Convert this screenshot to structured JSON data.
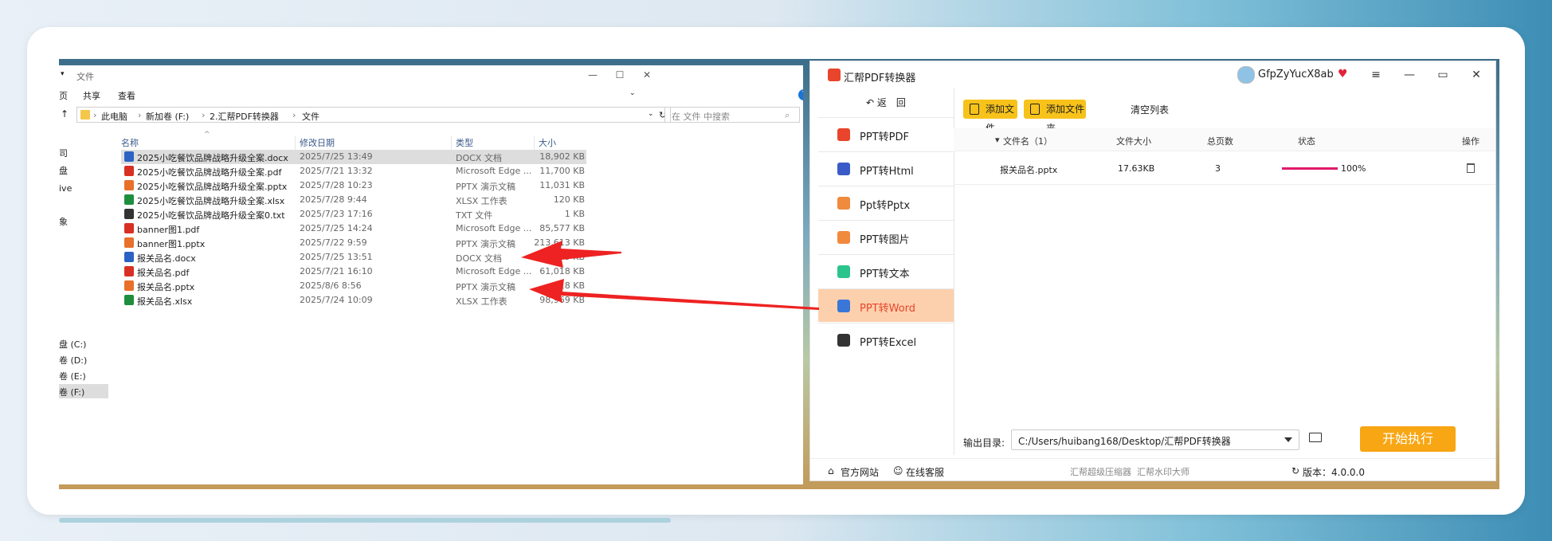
{
  "explorer": {
    "title": "文件",
    "menu": [
      "页",
      "共享",
      "查看"
    ],
    "breadcrumb": [
      "此电脑",
      "新加卷 (F:)",
      "2.汇帮PDF转换器",
      "文件"
    ],
    "search_placeholder": "在 文件 中搜索",
    "sidebar": [
      "司",
      "盘",
      "ive",
      "象",
      "盘 (C:)",
      "卷 (D:)",
      "卷 (E:)",
      "卷 (F:)"
    ],
    "columns": [
      "名称",
      "修改日期",
      "类型",
      "大小"
    ],
    "files": [
      {
        "name": "2025小吃餐饮品牌战略升级全案.docx",
        "date": "2025/7/25 13:49",
        "type": "DOCX 文档",
        "size": "18,902 KB",
        "icon": "word-icon",
        "color": "#2b62c4"
      },
      {
        "name": "2025小吃餐饮品牌战略升级全案.pdf",
        "date": "2025/7/21 13:32",
        "type": "Microsoft Edge ...",
        "size": "11,700 KB",
        "icon": "pdf-icon",
        "color": "#d93025"
      },
      {
        "name": "2025小吃餐饮品牌战略升级全案.pptx",
        "date": "2025/7/28 10:23",
        "type": "PPTX 演示文稿",
        "size": "11,031 KB",
        "icon": "ppt-icon",
        "color": "#e8702a"
      },
      {
        "name": "2025小吃餐饮品牌战略升级全案.xlsx",
        "date": "2025/7/28 9:44",
        "type": "XLSX 工作表",
        "size": "120 KB",
        "icon": "excel-icon",
        "color": "#1e8e3e"
      },
      {
        "name": "2025小吃餐饮品牌战略升级全案0.txt",
        "date": "2025/7/23 17:16",
        "type": "TXT 文件",
        "size": "1 KB",
        "icon": "txt-icon",
        "color": "#333333"
      },
      {
        "name": "banner图1.pdf",
        "date": "2025/7/25 14:24",
        "type": "Microsoft Edge ...",
        "size": "85,577 KB",
        "icon": "pdf-icon",
        "color": "#d93025"
      },
      {
        "name": "banner图1.pptx",
        "date": "2025/7/22 9:59",
        "type": "PPTX 演示文稿",
        "size": "213,613 KB",
        "icon": "ppt-icon",
        "color": "#e8702a"
      },
      {
        "name": "报关品名.docx",
        "date": "2025/7/25 13:51",
        "type": "DOCX 文档",
        "size": "9 KB",
        "icon": "word-icon",
        "color": "#2b62c4"
      },
      {
        "name": "报关品名.pdf",
        "date": "2025/7/21 16:10",
        "type": "Microsoft Edge ...",
        "size": "61,018 KB",
        "icon": "pdf-icon",
        "color": "#d93025"
      },
      {
        "name": "报关品名.pptx",
        "date": "2025/8/6 8:56",
        "type": "PPTX 演示文稿",
        "size": "18 KB",
        "icon": "ppt-icon",
        "color": "#e8702a"
      },
      {
        "name": "报关品名.xlsx",
        "date": "2025/7/24 10:09",
        "type": "XLSX 工作表",
        "size": "98,969 KB",
        "icon": "excel-icon",
        "color": "#1e8e3e"
      }
    ]
  },
  "app": {
    "title": "汇帮PDF转换器",
    "username": "GfpZyYucX8ab",
    "back_label": "返　回",
    "nav": [
      {
        "label": "PPT转PDF",
        "icon": "pdf-icon",
        "color": "#e8452c"
      },
      {
        "label": "PPT转Html",
        "icon": "html-icon",
        "color": "#3a5bc7"
      },
      {
        "label": "Ppt转Pptx",
        "icon": "pptx-icon",
        "color": "#f08a3c"
      },
      {
        "label": "PPT转图片",
        "icon": "image-icon",
        "color": "#f08a3c"
      },
      {
        "label": "PPT转文本",
        "icon": "text-icon",
        "color": "#2bc48c"
      },
      {
        "label": "PPT转Word",
        "icon": "word-icon",
        "color": "#3a76d8"
      },
      {
        "label": "PPT转Excel",
        "icon": "excel-icon",
        "color": "#333333"
      }
    ],
    "active_nav": 5,
    "add_file": "添加文件",
    "add_folder": "添加文件夹",
    "clear_list": "清空列表",
    "table_headers": [
      "文件名（1）",
      "文件大小",
      "总页数",
      "状态",
      "操作"
    ],
    "row": {
      "name": "报关品名.pptx",
      "size": "17.63KB",
      "pages": "3",
      "progress": 100,
      "progress_text": "100%"
    },
    "output_label": "输出目录:",
    "output_path": "C:/Users/huibang168/Desktop/汇帮PDF转换器",
    "start_button": "开始执行",
    "footer": {
      "website": "官方网站",
      "service": "在线客服",
      "compress": "汇帮超级压缩器",
      "watermark": "汇帮水印大师",
      "version": "版本：4.0.0.0"
    }
  },
  "colors": {
    "accent": "#f7c21a",
    "start": "#f8a613",
    "active_nav_bg": "#fdd0ad",
    "arrow": "#ee2222"
  }
}
